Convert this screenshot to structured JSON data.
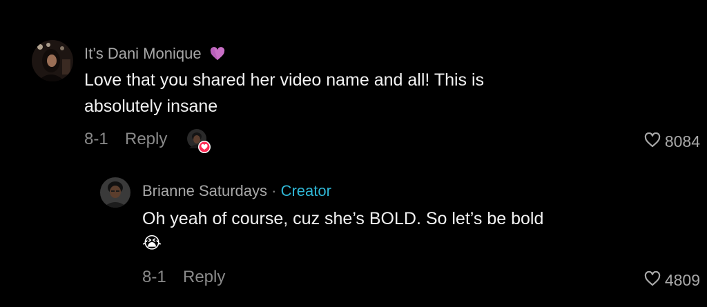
{
  "comments": [
    {
      "username": "It’s Dani Monique",
      "badge_icon": "purple-heart-icon",
      "text_line1": "Love that you shared her video name and all! This is",
      "text_line2": "absolutely insane",
      "date": "8-1",
      "reply_label": "Reply",
      "creator_liked": true,
      "like_count": "8084"
    },
    {
      "username": "Brianne Saturdays",
      "separator": "·",
      "role_label": "Creator",
      "text": "Oh yeah of course, cuz she’s BOLD. So let’s be bold",
      "emoji": "😭",
      "date": "8-1",
      "reply_label": "Reply",
      "like_count": "4809"
    }
  ],
  "colors": {
    "background": "#000000",
    "username": "#a8a8a8",
    "text": "#f2f2f2",
    "meta": "#8a8a8a",
    "creator": "#2fb7d6",
    "heart_badge": "#fe2c55"
  }
}
